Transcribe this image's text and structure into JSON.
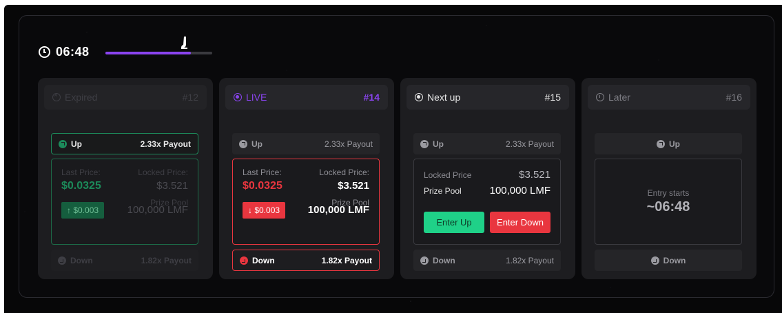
{
  "timer": {
    "value": "06:48",
    "progress": 0.8
  },
  "cards": {
    "expired": {
      "status": "Expired",
      "round": "#12",
      "up_label": "Up",
      "up_payout": "2.33x Payout",
      "last_price_label": "Last Price:",
      "last_price": "$0.0325",
      "locked_label": "Locked Price:",
      "locked_price": "$3.521",
      "change": "↑ $0.003",
      "pool_label": "Prize Pool",
      "pool": "100,000 LMF",
      "down_label": "Down",
      "down_payout": "1.82x Payout"
    },
    "live": {
      "status": "LIVE",
      "round": "#14",
      "up_label": "Up",
      "up_payout": "2.33x Payout",
      "last_price_label": "Last Price:",
      "last_price": "$0.0325",
      "locked_label": "Locked Price:",
      "locked_price": "$3.521",
      "change": "↓ $0.003",
      "pool_label": "Prize Pool",
      "pool": "100,000 LMF",
      "down_label": "Down",
      "down_payout": "1.82x Payout"
    },
    "next": {
      "status": "Next up",
      "round": "#15",
      "up_label": "Up",
      "up_payout": "2.33x Payout",
      "locked_label": "Locked Price",
      "locked_price": "$3.521",
      "pool_label": "Prize Pool",
      "pool": "100,000 LMF",
      "enter_up": "Enter Up",
      "enter_down": "Enter Down",
      "down_label": "Down",
      "down_payout": "1.82x Payout"
    },
    "later": {
      "status": "Later",
      "round": "#16",
      "up_label": "Up",
      "entry_label": "Entry starts",
      "entry_time": "~06:48",
      "down_label": "Down"
    }
  },
  "colors": {
    "accent": "#8a44f0",
    "green": "#1fd188",
    "red": "#e9363f",
    "expired_green": "#1c8a5a"
  }
}
